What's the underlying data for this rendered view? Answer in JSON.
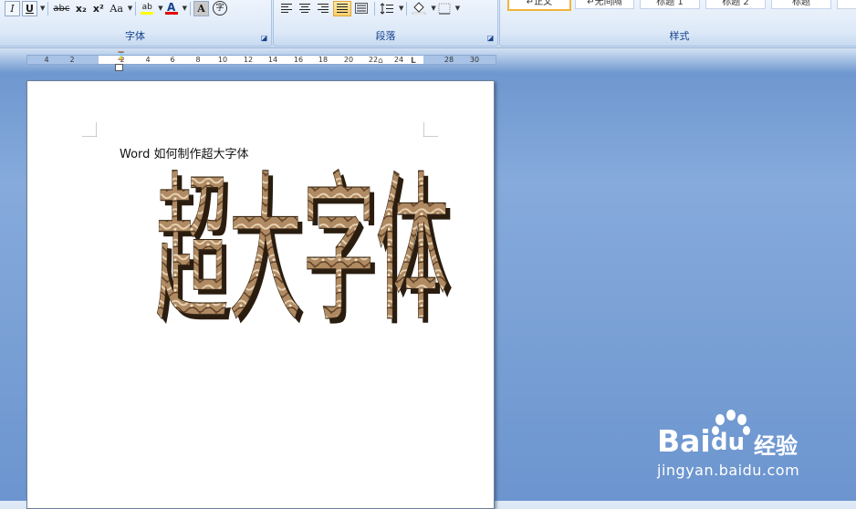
{
  "ribbon": {
    "font_group": {
      "title": "字体",
      "buttons": {
        "italic": "I",
        "underline": "U",
        "strikethrough": "abc",
        "subscript": "x₂",
        "superscript": "x²",
        "change_case": "Aa",
        "highlight": "ab",
        "font_color": "A",
        "char_shading": "A",
        "enclose_char": "字"
      }
    },
    "paragraph_group": {
      "title": "段落"
    },
    "styles_group": {
      "title": "样式",
      "items": [
        "↵正文",
        "↵无间隔",
        "标题 1",
        "标题 2",
        "标题",
        ""
      ]
    }
  },
  "ruler": {
    "ticks": [
      "4",
      "2",
      "2",
      "4",
      "6",
      "8",
      "10",
      "12",
      "14",
      "16",
      "18",
      "20",
      "22",
      "24",
      "28",
      "30"
    ]
  },
  "document": {
    "line": "Word 如何制作超大字体",
    "wordart": "超大字体"
  },
  "watermark": {
    "logo_left": "Bai",
    "logo_right": "du",
    "product": "经验",
    "url": "jingyan.baidu.com"
  },
  "colors": {
    "ribbon_title": "#15428b",
    "highlight": "#ffff00",
    "font_color_bar": "#e00000",
    "selected_style_border": "#f2b33a",
    "background_blue": "#6c95cf"
  }
}
